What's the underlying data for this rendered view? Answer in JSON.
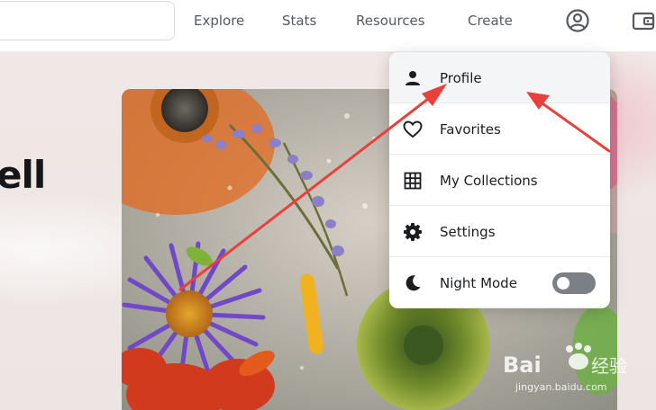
{
  "nav": {
    "links": [
      "Explore",
      "Stats",
      "Resources",
      "Create"
    ],
    "profile_icon": "user-circle-icon",
    "wallet_icon": "wallet-icon"
  },
  "hero": {
    "heading_fragment": "ell"
  },
  "dropdown": {
    "items": [
      {
        "label": "Profile",
        "icon": "person-icon"
      },
      {
        "label": "Favorites",
        "icon": "heart-icon"
      },
      {
        "label": "My Collections",
        "icon": "grid-icon"
      },
      {
        "label": "Settings",
        "icon": "gear-icon"
      },
      {
        "label": "Night Mode",
        "icon": "moon-icon"
      }
    ],
    "night_mode_on": false
  },
  "watermark": {
    "brand": "Baidu 经验",
    "url": "jingyan.baidu.com"
  },
  "colors": {
    "annotation_arrow": "#e8413b",
    "toggle_off": "#7b7f86"
  }
}
